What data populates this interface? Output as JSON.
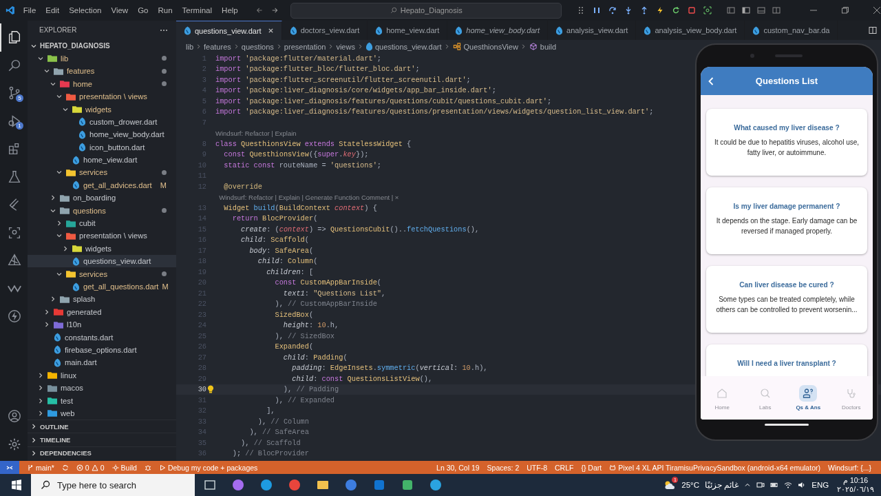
{
  "title_bar": {
    "menu": [
      "File",
      "Edit",
      "Selection",
      "View",
      "Go",
      "Run",
      "Terminal",
      "Help"
    ],
    "search": {
      "value": "Hepato_Diagnosis"
    }
  },
  "activity_bar": {
    "top": [
      {
        "kind": "files",
        "selected": true
      },
      {
        "kind": "search",
        "selected": false
      },
      {
        "kind": "scm",
        "selected": false,
        "badge": "5"
      },
      {
        "kind": "debug",
        "selected": false,
        "badge": "1"
      },
      {
        "kind": "extensions",
        "selected": false
      },
      {
        "kind": "testing",
        "selected": false
      },
      {
        "kind": "flutter",
        "selected": false
      },
      {
        "kind": "scan",
        "selected": false
      },
      {
        "kind": "triangle",
        "selected": false
      },
      {
        "kind": "windsurf",
        "selected": false
      },
      {
        "kind": "lightning",
        "selected": false
      }
    ],
    "bottom": [
      {
        "kind": "account",
        "selected": false
      },
      {
        "kind": "settings",
        "selected": false
      }
    ]
  },
  "explorer": {
    "title": "EXPLORER",
    "root": "HEPATO_DIAGNOSIS",
    "tree": [
      {
        "kind": "folder",
        "name": "lib",
        "color": "#8bc34a",
        "expanded": true,
        "modified": true,
        "dot": true,
        "selected": false,
        "children": [
          {
            "kind": "folder",
            "name": "features",
            "color": "#90a4ae",
            "expanded": true,
            "modified": true,
            "dot": true,
            "selected": false,
            "children": [
              {
                "kind": "folder",
                "name": "home",
                "color": "#e53950",
                "expanded": true,
                "modified": true,
                "dot": true,
                "selected": false,
                "children": [
                  {
                    "kind": "folder",
                    "name": "presentation \\ views",
                    "color": "#ef5a42",
                    "expanded": true,
                    "modified": true,
                    "dot": false,
                    "selected": false,
                    "children": [
                      {
                        "kind": "folder",
                        "name": "widgets",
                        "color": "#d8d83a",
                        "expanded": true,
                        "modified": true,
                        "dot": false,
                        "selected": false,
                        "children": [
                          {
                            "kind": "file",
                            "name": "custom_drower.dart",
                            "modified": false,
                            "selected": false
                          },
                          {
                            "kind": "file",
                            "name": "home_view_body.dart",
                            "modified": false,
                            "selected": false
                          },
                          {
                            "kind": "file",
                            "name": "icon_button.dart",
                            "modified": false,
                            "selected": false
                          }
                        ]
                      },
                      {
                        "kind": "file",
                        "name": "home_view.dart",
                        "modified": false,
                        "selected": false
                      }
                    ]
                  },
                  {
                    "kind": "folder",
                    "name": "services",
                    "color": "#f4c430",
                    "expanded": true,
                    "modified": true,
                    "dot": true,
                    "selected": false,
                    "children": [
                      {
                        "kind": "file",
                        "name": "get_all_advices.dart",
                        "modified": true,
                        "badge": "M",
                        "selected": false
                      }
                    ]
                  }
                ]
              },
              {
                "kind": "folder",
                "name": "on_boarding",
                "color": "#90a4ae",
                "expanded": false,
                "modified": false,
                "dot": false,
                "selected": false
              },
              {
                "kind": "folder",
                "name": "questions",
                "color": "#90a4ae",
                "expanded": true,
                "modified": true,
                "dot": true,
                "selected": false,
                "children": [
                  {
                    "kind": "folder",
                    "name": "cubit",
                    "color": "#26a69a",
                    "expanded": false,
                    "modified": false,
                    "dot": false,
                    "selected": false
                  },
                  {
                    "kind": "folder",
                    "name": "presentation \\ views",
                    "color": "#ef5a42",
                    "expanded": true,
                    "modified": false,
                    "dot": false,
                    "selected": false,
                    "children": [
                      {
                        "kind": "folder",
                        "name": "widgets",
                        "color": "#d8d83a",
                        "expanded": false,
                        "modified": false,
                        "dot": false,
                        "selected": false
                      },
                      {
                        "kind": "file",
                        "name": "questions_view.dart",
                        "modified": false,
                        "selected": true
                      }
                    ]
                  },
                  {
                    "kind": "folder",
                    "name": "services",
                    "color": "#f4c430",
                    "expanded": true,
                    "modified": true,
                    "dot": true,
                    "selected": false,
                    "children": [
                      {
                        "kind": "file",
                        "name": "get_all_questions.dart",
                        "modified": true,
                        "badge": "M",
                        "selected": false
                      }
                    ]
                  }
                ]
              },
              {
                "kind": "folder",
                "name": "splash",
                "color": "#90a4ae",
                "expanded": false,
                "modified": false,
                "dot": false,
                "selected": false
              }
            ]
          },
          {
            "kind": "folder",
            "name": "generated",
            "color": "#e53935",
            "expanded": false,
            "modified": false,
            "dot": false,
            "selected": false
          },
          {
            "kind": "folder",
            "name": "l10n",
            "color": "#7e6bd6",
            "expanded": false,
            "modified": false,
            "dot": false,
            "selected": false
          },
          {
            "kind": "file",
            "name": "constants.dart",
            "modified": false,
            "selected": false
          },
          {
            "kind": "file",
            "name": "firebase_options.dart",
            "modified": false,
            "selected": false
          },
          {
            "kind": "file",
            "name": "main.dart",
            "modified": false,
            "selected": false
          }
        ]
      },
      {
        "kind": "folder",
        "name": "linux",
        "color": "#f4b400",
        "expanded": false,
        "modified": false,
        "dot": false,
        "selected": false
      },
      {
        "kind": "folder",
        "name": "macos",
        "color": "#78909c",
        "expanded": false,
        "modified": false,
        "dot": false,
        "selected": false
      },
      {
        "kind": "folder",
        "name": "test",
        "color": "#26bfa5",
        "expanded": false,
        "modified": false,
        "dot": false,
        "selected": false
      },
      {
        "kind": "folder",
        "name": "web",
        "color": "#2f9be0",
        "expanded": false,
        "modified": false,
        "dot": false,
        "selected": false
      }
    ],
    "sections": [
      "OUTLINE",
      "TIMELINE",
      "DEPENDENCIES"
    ]
  },
  "tabs": [
    {
      "label": "questions_view.dart",
      "selected": true,
      "preview": false
    },
    {
      "label": "doctors_view.dart",
      "selected": false,
      "preview": false
    },
    {
      "label": "home_view.dart",
      "selected": false,
      "preview": false
    },
    {
      "label": "home_view_body.dart",
      "selected": false,
      "preview": true
    },
    {
      "label": "analysis_view.dart",
      "selected": false,
      "preview": false
    },
    {
      "label": "analysis_view_body.dart",
      "selected": false,
      "preview": false
    },
    {
      "label": "custom_nav_bar.da",
      "selected": false,
      "preview": false
    }
  ],
  "breadcrumb": [
    {
      "kind": "folder",
      "text": "lib"
    },
    {
      "kind": "folder",
      "text": "features"
    },
    {
      "kind": "folder",
      "text": "questions"
    },
    {
      "kind": "folder",
      "text": "presentation"
    },
    {
      "kind": "folder",
      "text": "views"
    },
    {
      "kind": "file",
      "text": "questions_view.dart"
    },
    {
      "kind": "class",
      "text": "QuesthionsView"
    },
    {
      "kind": "method",
      "text": "build"
    }
  ],
  "code": [
    {
      "kind": "line",
      "n": "1",
      "current": false,
      "tokens": [
        {
          "t": "import",
          "kind": "kw"
        },
        {
          "t": " 'package:flutter/material.dart'",
          "kind": "str"
        },
        {
          "t": ";",
          "kind": "p"
        }
      ]
    },
    {
      "kind": "line",
      "n": "2",
      "current": false,
      "tokens": [
        {
          "t": "import",
          "kind": "kw"
        },
        {
          "t": " 'package:flutter_bloc/flutter_bloc.dart'",
          "kind": "str"
        },
        {
          "t": ";",
          "kind": "p"
        }
      ]
    },
    {
      "kind": "line",
      "n": "3",
      "current": false,
      "tokens": [
        {
          "t": "import",
          "kind": "kw"
        },
        {
          "t": " 'package:flutter_screenutil/flutter_screenutil.dart'",
          "kind": "str"
        },
        {
          "t": ";",
          "kind": "p"
        }
      ]
    },
    {
      "kind": "line",
      "n": "4",
      "current": false,
      "tokens": [
        {
          "t": "import",
          "kind": "kw"
        },
        {
          "t": " 'package:liver_diagnosis/core/widgets/app_bar_inside.dart'",
          "kind": "str"
        },
        {
          "t": ";",
          "kind": "p"
        }
      ]
    },
    {
      "kind": "line",
      "n": "5",
      "current": false,
      "tokens": [
        {
          "t": "import",
          "kind": "kw"
        },
        {
          "t": " 'package:liver_diagnosis/features/questions/cubit/questions_cubit.dart'",
          "kind": "str"
        },
        {
          "t": ";",
          "kind": "p"
        }
      ]
    },
    {
      "kind": "line",
      "n": "6",
      "current": false,
      "tokens": [
        {
          "t": "import",
          "kind": "kw"
        },
        {
          "t": " 'package:liver_diagnosis/features/questions/presentation/views/widgets/question_list_view.dart'",
          "kind": "str"
        },
        {
          "t": ";",
          "kind": "p"
        }
      ]
    },
    {
      "kind": "line",
      "n": "7",
      "current": false
    },
    {
      "kind": "lens",
      "text": "Windsurf: Refactor | Explain"
    },
    {
      "kind": "line",
      "n": "8",
      "current": false,
      "tokens": [
        {
          "t": "class",
          "kind": "kw"
        },
        {
          "t": " QuesthionsView",
          "kind": "cls"
        },
        {
          "t": " extends",
          "kind": "kw"
        },
        {
          "t": " StatelessWidget",
          "kind": "cls"
        },
        {
          "t": " {",
          "kind": "p"
        }
      ]
    },
    {
      "kind": "line",
      "n": "9",
      "current": false,
      "tokens": [
        {
          "t": "  const",
          "kind": "kw"
        },
        {
          "t": " QuesthionsView",
          "kind": "cls"
        },
        {
          "t": "({",
          "kind": "p"
        },
        {
          "t": "super",
          "kind": "kw"
        },
        {
          "t": ".",
          "kind": "p"
        },
        {
          "t": "key",
          "kind": "prm"
        },
        {
          "t": "});",
          "kind": "p"
        }
      ]
    },
    {
      "kind": "line",
      "n": "10",
      "current": false,
      "tokens": [
        {
          "t": "  static const",
          "kind": "kw"
        },
        {
          "t": " routeName = ",
          "kind": "p"
        },
        {
          "t": "'questions'",
          "kind": "str"
        },
        {
          "t": ";",
          "kind": "p"
        }
      ]
    },
    {
      "kind": "line",
      "n": "11",
      "current": false
    },
    {
      "kind": "line",
      "n": "12",
      "current": false,
      "tokens": [
        {
          "t": "  @override",
          "kind": "deco"
        }
      ]
    },
    {
      "kind": "lens",
      "text": "  Windsurf: Refactor | Explain | Generate Function Comment | ×"
    },
    {
      "kind": "line",
      "n": "13",
      "current": false,
      "tokens": [
        {
          "t": "  Widget",
          "kind": "cls"
        },
        {
          "t": " build",
          "kind": "fn"
        },
        {
          "t": "(",
          "kind": "p"
        },
        {
          "t": "BuildContext",
          "kind": "cls"
        },
        {
          "t": " context",
          "kind": "prm"
        },
        {
          "t": ") {",
          "kind": "p"
        }
      ]
    },
    {
      "kind": "line",
      "n": "14",
      "current": false,
      "tokens": [
        {
          "t": "    return",
          "kind": "kw"
        },
        {
          "t": " BlocProvider",
          "kind": "cls"
        },
        {
          "t": "(",
          "kind": "p"
        }
      ]
    },
    {
      "kind": "line",
      "n": "15",
      "current": false,
      "tokens": [
        {
          "t": "      create",
          "kind": "named"
        },
        {
          "t": ": (",
          "kind": "p"
        },
        {
          "t": "context",
          "kind": "prm"
        },
        {
          "t": ") => ",
          "kind": "p"
        },
        {
          "t": "QuestionsCubit",
          "kind": "cls"
        },
        {
          "t": "()..",
          "kind": "p"
        },
        {
          "t": "fetchQuestions",
          "kind": "fn"
        },
        {
          "t": "(),",
          "kind": "p"
        }
      ]
    },
    {
      "kind": "line",
      "n": "16",
      "current": false,
      "tokens": [
        {
          "t": "      child",
          "kind": "named"
        },
        {
          "t": ": ",
          "kind": "p"
        },
        {
          "t": "Scaffold",
          "kind": "cls"
        },
        {
          "t": "(",
          "kind": "p"
        }
      ]
    },
    {
      "kind": "line",
      "n": "17",
      "current": false,
      "tokens": [
        {
          "t": "        body",
          "kind": "named"
        },
        {
          "t": ": ",
          "kind": "p"
        },
        {
          "t": "SafeArea",
          "kind": "cls"
        },
        {
          "t": "(",
          "kind": "p"
        }
      ]
    },
    {
      "kind": "line",
      "n": "18",
      "current": false,
      "tokens": [
        {
          "t": "          child",
          "kind": "named"
        },
        {
          "t": ": ",
          "kind": "p"
        },
        {
          "t": "Column",
          "kind": "cls"
        },
        {
          "t": "(",
          "kind": "p"
        }
      ]
    },
    {
      "kind": "line",
      "n": "19",
      "current": false,
      "tokens": [
        {
          "t": "            children",
          "kind": "named"
        },
        {
          "t": ": [",
          "kind": "p"
        }
      ]
    },
    {
      "kind": "line",
      "n": "20",
      "current": false,
      "tokens": [
        {
          "t": "              const",
          "kind": "kw"
        },
        {
          "t": " CustomAppBarInside",
          "kind": "cls"
        },
        {
          "t": "(",
          "kind": "p"
        }
      ]
    },
    {
      "kind": "line",
      "n": "21",
      "current": false,
      "tokens": [
        {
          "t": "                text1",
          "kind": "named"
        },
        {
          "t": ": ",
          "kind": "p"
        },
        {
          "t": "\"Questions List\"",
          "kind": "str"
        },
        {
          "t": ",",
          "kind": "p"
        }
      ]
    },
    {
      "kind": "line",
      "n": "22",
      "current": false,
      "tokens": [
        {
          "t": "              ), ",
          "kind": "p"
        },
        {
          "t": "// CustomAppBarInside",
          "kind": "cm"
        }
      ]
    },
    {
      "kind": "line",
      "n": "23",
      "current": false,
      "tokens": [
        {
          "t": "              SizedBox",
          "kind": "cls"
        },
        {
          "t": "(",
          "kind": "p"
        }
      ]
    },
    {
      "kind": "line",
      "n": "24",
      "current": false,
      "tokens": [
        {
          "t": "                height",
          "kind": "named"
        },
        {
          "t": ": ",
          "kind": "p"
        },
        {
          "t": "10",
          "kind": "num"
        },
        {
          "t": ".h,",
          "kind": "p"
        }
      ]
    },
    {
      "kind": "line",
      "n": "25",
      "current": false,
      "tokens": [
        {
          "t": "              ), ",
          "kind": "p"
        },
        {
          "t": "// SizedBox",
          "kind": "cm"
        }
      ]
    },
    {
      "kind": "line",
      "n": "26",
      "current": false,
      "tokens": [
        {
          "t": "              Expanded",
          "kind": "cls"
        },
        {
          "t": "(",
          "kind": "p"
        }
      ]
    },
    {
      "kind": "line",
      "n": "27",
      "current": false,
      "tokens": [
        {
          "t": "                child",
          "kind": "named"
        },
        {
          "t": ": ",
          "kind": "p"
        },
        {
          "t": "Padding",
          "kind": "cls"
        },
        {
          "t": "(",
          "kind": "p"
        }
      ]
    },
    {
      "kind": "line",
      "n": "28",
      "current": false,
      "tokens": [
        {
          "t": "                  padding",
          "kind": "named"
        },
        {
          "t": ": ",
          "kind": "p"
        },
        {
          "t": "EdgeInsets",
          "kind": "cls"
        },
        {
          "t": ".",
          "kind": "p"
        },
        {
          "t": "symmetric",
          "kind": "fn"
        },
        {
          "t": "(",
          "kind": "p"
        },
        {
          "t": "vertical",
          "kind": "named"
        },
        {
          "t": ": ",
          "kind": "p"
        },
        {
          "t": "10",
          "kind": "num"
        },
        {
          "t": ".h),",
          "kind": "p"
        }
      ]
    },
    {
      "kind": "line",
      "n": "29",
      "current": false,
      "tokens": [
        {
          "t": "                  child",
          "kind": "named"
        },
        {
          "t": ": ",
          "kind": "p"
        },
        {
          "t": "const",
          "kind": "kw"
        },
        {
          "t": " QuestionsListView",
          "kind": "cls"
        },
        {
          "t": "(),",
          "kind": "p"
        }
      ]
    },
    {
      "kind": "line",
      "n": "30",
      "current": true,
      "tokens": [
        {
          "t": "                ), ",
          "kind": "p"
        },
        {
          "t": "// Padding",
          "kind": "cm"
        }
      ]
    },
    {
      "kind": "line",
      "n": "31",
      "current": false,
      "tokens": [
        {
          "t": "              ), ",
          "kind": "p"
        },
        {
          "t": "// Expanded",
          "kind": "cm"
        }
      ]
    },
    {
      "kind": "line",
      "n": "32",
      "current": false,
      "tokens": [
        {
          "t": "            ],",
          "kind": "p"
        }
      ]
    },
    {
      "kind": "line",
      "n": "33",
      "current": false,
      "tokens": [
        {
          "t": "          ), ",
          "kind": "p"
        },
        {
          "t": "// Column",
          "kind": "cm"
        }
      ]
    },
    {
      "kind": "line",
      "n": "34",
      "current": false,
      "tokens": [
        {
          "t": "        ), ",
          "kind": "p"
        },
        {
          "t": "// SafeArea",
          "kind": "cm"
        }
      ]
    },
    {
      "kind": "line",
      "n": "35",
      "current": false,
      "tokens": [
        {
          "t": "      ), ",
          "kind": "p"
        },
        {
          "t": "// Scaffold",
          "kind": "cm"
        }
      ]
    },
    {
      "kind": "line",
      "n": "36",
      "current": false,
      "tokens": [
        {
          "t": "    ); ",
          "kind": "p"
        },
        {
          "t": "// BlocProvider",
          "kind": "cm"
        }
      ]
    }
  ],
  "emulator": {
    "app_bar": {
      "title": "Questions List"
    },
    "cards": [
      {
        "question": "What caused my liver disease ?",
        "answer": "It could be due to hepatitis viruses, alcohol use, fatty liver, or autoimmune."
      },
      {
        "question": "Is my liver damage permanent ?",
        "answer": "It depends on the stage. Early damage can be reversed if managed properly."
      },
      {
        "question": "Can liver disease be cured ?",
        "answer": "Some types can be treated completely, while others can be controlled to prevent worsenin..."
      },
      {
        "question": "Will I need a liver transplant ?"
      }
    ],
    "nav": [
      {
        "kind": "home",
        "label": "Home",
        "selected": false
      },
      {
        "kind": "labs",
        "label": "Labs",
        "selected": false
      },
      {
        "kind": "qa",
        "label": "Qs & Ans",
        "selected": true
      },
      {
        "kind": "doctors",
        "label": "Doctors",
        "selected": false
      }
    ]
  },
  "status_bar": {
    "left": [
      {
        "kind": "branch",
        "text": "main*"
      },
      {
        "kind": "sync"
      },
      {
        "kind": "problems",
        "errors": "0",
        "warnings": "0"
      },
      {
        "kind": "build",
        "text": "Build"
      },
      {
        "kind": "bug"
      },
      {
        "kind": "play",
        "text": "Debug my code + packages"
      }
    ],
    "right": [
      {
        "kind": "text",
        "text": "Ln 30, Col 19"
      },
      {
        "kind": "text",
        "text": "Spaces: 2"
      },
      {
        "kind": "text",
        "text": "UTF-8"
      },
      {
        "kind": "text",
        "text": "CRLF"
      },
      {
        "kind": "text",
        "text": "{} Dart"
      },
      {
        "kind": "device",
        "text": "Pixel 4 XL API TiramisuPrivacySandbox (android-x64 emulator)"
      },
      {
        "kind": "text",
        "text": "Windsurf: {...}"
      }
    ]
  },
  "taskbar": {
    "search": {
      "placeholder": "Type here to search"
    },
    "apps": [
      {
        "kind": "taskview"
      },
      {
        "kind": "copilot"
      },
      {
        "kind": "edge"
      },
      {
        "kind": "chrome"
      },
      {
        "kind": "files"
      },
      {
        "kind": "studio"
      },
      {
        "kind": "outlook"
      },
      {
        "kind": "phone"
      },
      {
        "kind": "telegram"
      }
    ],
    "weather": {
      "badge": "1",
      "temp": "25°C",
      "condition": "غائم جزئيًا"
    },
    "language": "ENG",
    "time": "10:16 م",
    "date": "٢٠٢٥/٠٦/١٩"
  }
}
